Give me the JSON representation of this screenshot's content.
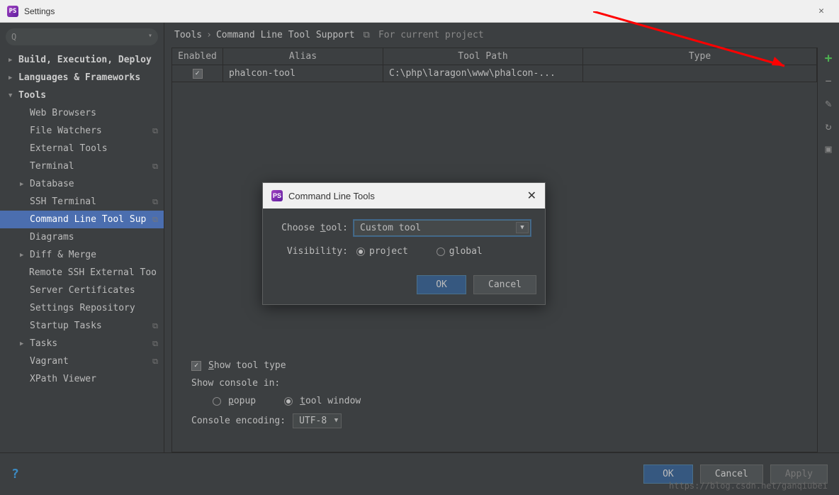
{
  "titlebar": {
    "title": "Settings"
  },
  "search": {
    "placeholder": ""
  },
  "sidebar": {
    "items": [
      {
        "label": "Build, Execution, Deploy",
        "arrow": "▶",
        "level": 0
      },
      {
        "label": "Languages & Frameworks",
        "arrow": "▶",
        "level": 0
      },
      {
        "label": "Tools",
        "arrow": "▼",
        "level": 0
      },
      {
        "label": "Web Browsers",
        "arrow": "",
        "level": 1
      },
      {
        "label": "File Watchers",
        "arrow": "",
        "level": 1,
        "badge": "⧉"
      },
      {
        "label": "External Tools",
        "arrow": "",
        "level": 1
      },
      {
        "label": "Terminal",
        "arrow": "",
        "level": 1,
        "badge": "⧉"
      },
      {
        "label": "Database",
        "arrow": "▶",
        "level": 1
      },
      {
        "label": "SSH Terminal",
        "arrow": "",
        "level": 1,
        "badge": "⧉"
      },
      {
        "label": "Command Line Tool Sup",
        "arrow": "",
        "level": 1,
        "selected": true,
        "badge": "⧉"
      },
      {
        "label": "Diagrams",
        "arrow": "",
        "level": 1
      },
      {
        "label": "Diff & Merge",
        "arrow": "▶",
        "level": 1
      },
      {
        "label": "Remote SSH External Too",
        "arrow": "",
        "level": 1
      },
      {
        "label": "Server Certificates",
        "arrow": "",
        "level": 1
      },
      {
        "label": "Settings Repository",
        "arrow": "",
        "level": 1
      },
      {
        "label": "Startup Tasks",
        "arrow": "",
        "level": 1,
        "badge": "⧉"
      },
      {
        "label": "Tasks",
        "arrow": "▶",
        "level": 1,
        "badge": "⧉"
      },
      {
        "label": "Vagrant",
        "arrow": "",
        "level": 1,
        "badge": "⧉"
      },
      {
        "label": "XPath Viewer",
        "arrow": "",
        "level": 1
      }
    ]
  },
  "breadcrumb": {
    "part1": "Tools",
    "sep": "›",
    "part2": "Command Line Tool Support",
    "context": "For current project"
  },
  "table": {
    "headers": {
      "enabled": "Enabled",
      "alias": "Alias",
      "path": "Tool Path",
      "type": "Type"
    },
    "rows": [
      {
        "enabled": true,
        "alias": "phalcon-tool",
        "path": "C:\\php\\laragon\\www\\phalcon-...",
        "type": ""
      }
    ]
  },
  "options": {
    "show_tool_type": "Show tool type",
    "show_console_label": "Show console in:",
    "console_popup": "popup",
    "console_tool_window": "tool window",
    "encoding_label": "Console encoding:",
    "encoding_value": "UTF-8"
  },
  "dialog": {
    "title": "Command Line Tools",
    "choose_label": "Choose tool:",
    "choose_value": "Custom tool",
    "visibility_label": "Visibility:",
    "vis_project": "project",
    "vis_global": "global",
    "ok": "OK",
    "cancel": "Cancel"
  },
  "footer": {
    "ok": "OK",
    "cancel": "Cancel",
    "apply": "Apply"
  },
  "watermark": "https://blog.csdn.net/ganqiubei"
}
